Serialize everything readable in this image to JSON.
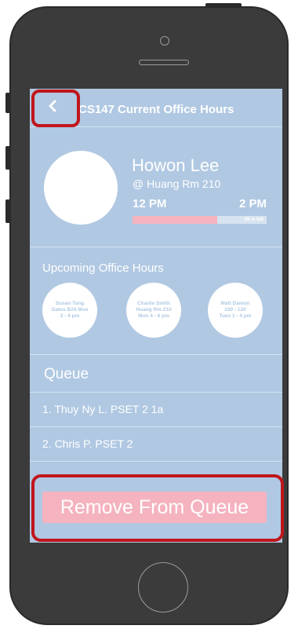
{
  "nav": {
    "title": "CS147 Current Office Hours",
    "back_icon": "chevron-left-icon"
  },
  "current_session": {
    "ta_name": "Howon Lee",
    "location": "@ Huang Rm 210",
    "start_time": "12 PM",
    "end_time": "2 PM",
    "time_left_label": "45 m left",
    "progress_fraction": 0.63
  },
  "upcoming": {
    "title": "Upcoming Office Hours",
    "sessions": [
      {
        "lines": [
          "Susan Tang",
          "Gates B24 Mon",
          "3 - 4 pm"
        ]
      },
      {
        "lines": [
          "Charlie Smith",
          "Huang Rm 210",
          "Mon 4 - 6 pm"
        ]
      },
      {
        "lines": [
          "Matt Damon",
          "330 - 120",
          "Tues 1 - 4 pm"
        ]
      }
    ]
  },
  "queue": {
    "title": "Queue",
    "items": [
      {
        "label": "1. Thuy Ny L. PSET 2 1a"
      },
      {
        "label": "2. Chris P. PSET 2"
      }
    ]
  },
  "actions": {
    "remove_label": "Remove From Queue"
  },
  "colors": {
    "screen_bg": "#b0c8e2",
    "accent_pink": "#f4b3bf",
    "highlight_red": "#c0161b",
    "phone_body": "#3b3b3b"
  }
}
